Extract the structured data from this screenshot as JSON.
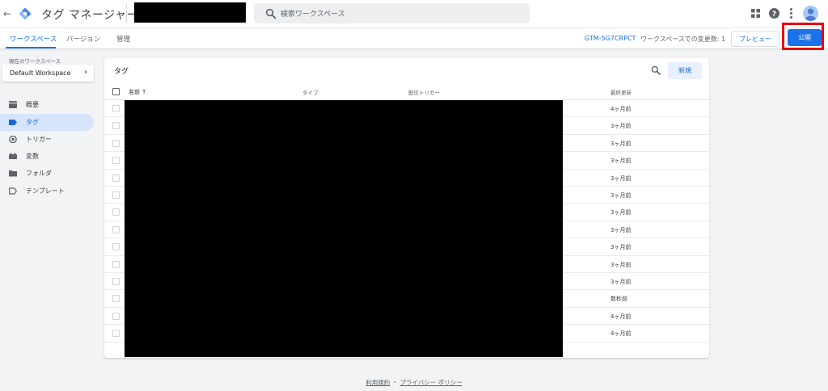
{
  "app": {
    "title": "タグ マネージャー",
    "search_placeholder": "検索ワークスペース"
  },
  "subnav": {
    "tabs": [
      "ワークスペース",
      "バージョン",
      "管理"
    ],
    "container_id": "GTM-5G7CRPCT",
    "changes_label": "ワークスペースでの変更数: 1",
    "preview_label": "プレビュー",
    "publish_label": "公開"
  },
  "sidebar": {
    "workspace_label": "現在のワークスペース",
    "workspace_name": "Default Workspace",
    "items": [
      {
        "label": "概要",
        "icon": "overview-icon"
      },
      {
        "label": "タグ",
        "icon": "tag-icon"
      },
      {
        "label": "トリガー",
        "icon": "trigger-icon"
      },
      {
        "label": "変数",
        "icon": "variable-icon"
      },
      {
        "label": "フォルダ",
        "icon": "folder-icon"
      },
      {
        "label": "テンプレート",
        "icon": "template-icon"
      }
    ],
    "active_index": 1
  },
  "table": {
    "title": "タグ",
    "new_label": "新規",
    "columns": [
      "名前 ↑",
      "タイプ",
      "配信トリガー",
      "最終更新"
    ],
    "rows": [
      {
        "last_edited": "4ヶ月前"
      },
      {
        "last_edited": "3ヶ月前"
      },
      {
        "last_edited": "3ヶ月前"
      },
      {
        "last_edited": "3ヶ月前"
      },
      {
        "last_edited": "3ヶ月前"
      },
      {
        "last_edited": "3ヶ月前"
      },
      {
        "last_edited": "3ヶ月前"
      },
      {
        "last_edited": "3ヶ月前"
      },
      {
        "last_edited": "3ヶ月前"
      },
      {
        "last_edited": "3ヶ月前"
      },
      {
        "last_edited": "3ヶ月前"
      },
      {
        "last_edited": "数秒前"
      },
      {
        "last_edited": "4ヶ月前"
      },
      {
        "last_edited": "4ヶ月前"
      }
    ]
  },
  "footer": {
    "terms": "利用規約",
    "separator": "・",
    "privacy": "プライバシー ポリシー"
  },
  "colors": {
    "accent": "#1a73e8",
    "highlight": "#e8000b",
    "redaction": "#000000"
  }
}
